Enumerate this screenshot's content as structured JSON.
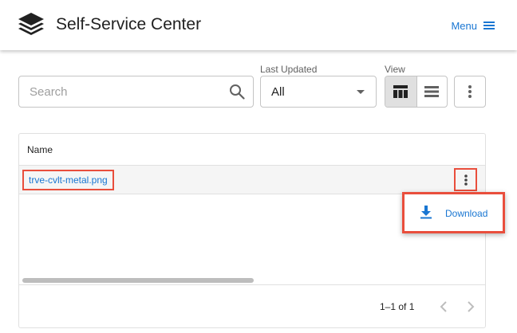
{
  "header": {
    "title": "Self-Service Center",
    "menu_label": "Menu",
    "logo_icon": "layers-stack-icon",
    "accent_color": "#1976d2"
  },
  "toolbar": {
    "search_placeholder": "Search",
    "last_updated_label": "Last Updated",
    "last_updated_value": "All",
    "view_label": "View",
    "view_options": [
      "grid-view-icon",
      "list-view-icon"
    ],
    "active_view": "grid-view-icon"
  },
  "table": {
    "columns": [
      "Name"
    ],
    "rows": [
      {
        "name": "trve-cvlt-metal.png"
      }
    ],
    "pagination": "1–1 of 1"
  },
  "row_menu": {
    "items": [
      {
        "label": "Download",
        "icon": "download-icon"
      }
    ]
  },
  "highlight_color": "#e94e3c"
}
